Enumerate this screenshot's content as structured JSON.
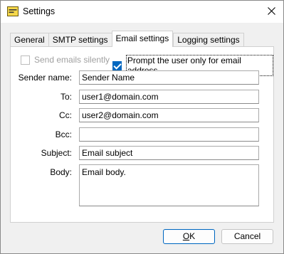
{
  "window": {
    "title": "Settings",
    "icon": "settings-app-icon"
  },
  "tabs": [
    {
      "label": "General",
      "active": false
    },
    {
      "label": "SMTP settings",
      "active": false
    },
    {
      "label": "Email settings",
      "active": true
    },
    {
      "label": "Logging settings",
      "active": false
    }
  ],
  "options": {
    "send_silently": {
      "label": "Send emails silently",
      "checked": false,
      "enabled": false
    },
    "prompt_user": {
      "label": "Prompt the user only for email address",
      "checked": true,
      "enabled": true
    }
  },
  "fields": {
    "sender_name": {
      "label": "Sender name:",
      "value": "Sender Name"
    },
    "to": {
      "label": "To:",
      "value": "user1@domain.com"
    },
    "cc": {
      "label": "Cc:",
      "value": "user2@domain.com"
    },
    "bcc": {
      "label": "Bcc:",
      "value": ""
    },
    "subject": {
      "label": "Subject:",
      "value": "Email subject"
    },
    "body": {
      "label": "Body:",
      "value": "Email body."
    }
  },
  "buttons": {
    "ok_label": "OK",
    "ok_label_mnemonic": "O",
    "ok_label_rest": "K",
    "cancel_label": "Cancel"
  },
  "colors": {
    "accent": "#0067c0",
    "panel_bg": "#ffffff",
    "window_bg": "#f0f0f0"
  }
}
